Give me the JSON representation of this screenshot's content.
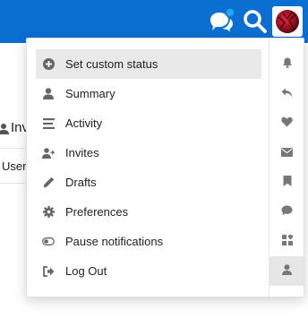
{
  "header": {
    "chat_icon": "chat-bubbles-icon",
    "search_icon": "search-icon",
    "avatar_icon": "user-avatar",
    "brand_color": "#0a6fd1",
    "notification_dot_color": "#1ea7f5"
  },
  "background": {
    "invite_text": "Inv",
    "user_text": "User"
  },
  "menu": {
    "items": [
      {
        "label": "Set custom status",
        "icon": "plus-circle-icon"
      },
      {
        "label": "Summary",
        "icon": "user-icon"
      },
      {
        "label": "Activity",
        "icon": "stream-icon"
      },
      {
        "label": "Invites",
        "icon": "user-plus-icon"
      },
      {
        "label": "Drafts",
        "icon": "pencil-icon"
      },
      {
        "label": "Preferences",
        "icon": "cog-icon"
      },
      {
        "label": "Pause notifications",
        "icon": "toggle-off-icon"
      },
      {
        "label": "Log Out",
        "icon": "sign-out-icon"
      }
    ],
    "side_tabs": [
      {
        "icon": "bell-icon"
      },
      {
        "icon": "reply-icon"
      },
      {
        "icon": "heart-icon"
      },
      {
        "icon": "envelope-icon"
      },
      {
        "icon": "bookmark-icon"
      },
      {
        "icon": "comment-icon"
      },
      {
        "icon": "grid-icon"
      },
      {
        "icon": "user-icon"
      }
    ]
  }
}
